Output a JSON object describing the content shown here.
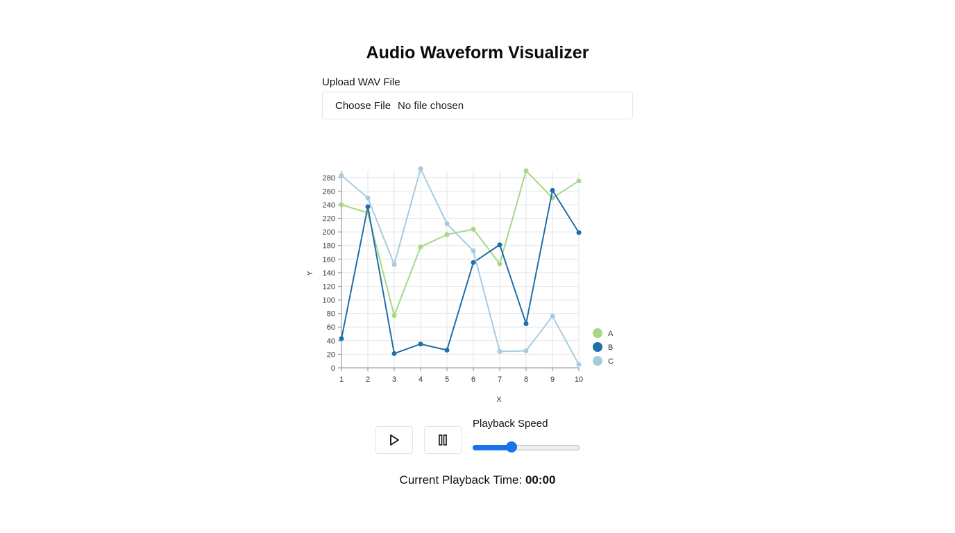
{
  "page": {
    "title": "Audio Waveform Visualizer"
  },
  "upload": {
    "label": "Upload WAV File",
    "button_label": "Choose File",
    "status": "No file chosen"
  },
  "playback": {
    "play_icon": "play-icon",
    "pause_icon": "pause-icon",
    "speed_label": "Playback Speed",
    "speed_fraction": 0.37,
    "time_label": "Current Playback Time:",
    "time_value": "00:00"
  },
  "colors": {
    "A": "#a6d886",
    "B": "#1f6fa8",
    "C": "#a6cbe0",
    "slider": "#1a73e8"
  },
  "chart_data": {
    "type": "line",
    "x": [
      1,
      2,
      3,
      4,
      5,
      6,
      7,
      8,
      9,
      10
    ],
    "series": [
      {
        "name": "A",
        "values": [
          240,
          228,
          77,
          178,
          196,
          204,
          153,
          290,
          250,
          275
        ]
      },
      {
        "name": "B",
        "values": [
          43,
          237,
          21,
          35,
          26,
          155,
          181,
          65,
          261,
          199
        ]
      },
      {
        "name": "C",
        "values": [
          283,
          250,
          152,
          293,
          212,
          172,
          24,
          25,
          76,
          5
        ]
      }
    ],
    "xlabel": "X",
    "ylabel": "Y",
    "xlim": [
      1,
      10
    ],
    "ylim": [
      0,
      290
    ],
    "yticks": [
      0,
      20,
      40,
      60,
      80,
      100,
      120,
      140,
      160,
      180,
      200,
      220,
      240,
      260,
      280
    ],
    "grid": true,
    "legend": "bottom-right"
  }
}
